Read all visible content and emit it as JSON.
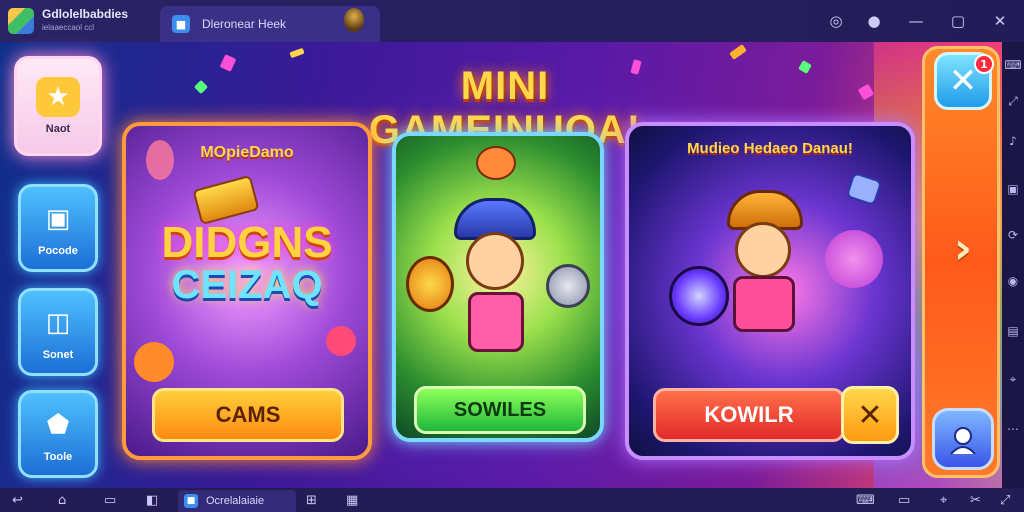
{
  "window": {
    "app_name": "Gdlolelbabdies",
    "app_subtitle": "ielaaeccaol ccl",
    "tab_label": "Dleronear Heek",
    "tab_icon": "app-icon"
  },
  "title": "MINI GAMEINUOA!",
  "sidebar": {
    "items": [
      {
        "label": "Naot",
        "icon": "home-star-icon",
        "active": true
      },
      {
        "label": "Pocode",
        "icon": "shop-bag-icon",
        "active": false
      },
      {
        "label": "Sonet",
        "icon": "trash-can-icon",
        "active": false
      },
      {
        "label": "Toole",
        "icon": "house-icon",
        "active": false
      }
    ]
  },
  "cards": [
    {
      "heading": "MOpieDamo",
      "art_line1": "DIDGNS",
      "art_line2": "CEIZAQ",
      "button": "CAMS"
    },
    {
      "heading": "",
      "button": "SOWILES"
    },
    {
      "heading": "Mudieo Hedaeo Danau!",
      "button": "KOWILR",
      "button_icon": "close-x-icon"
    }
  ],
  "right_panel": {
    "close_icon": "close-x-icon",
    "badge_count": "1",
    "next_icon": "chevron-right-icon",
    "profile_icon": "avatar-icon"
  },
  "bottombar": {
    "tab_label": "Ocrelalaiaie"
  },
  "colors": {
    "title": "#ffd84a",
    "card1_button": "#ff8a12",
    "card2_button": "#1fb83a",
    "card3_button": "#e32a2a",
    "right_panel": "#ff5a1a"
  }
}
